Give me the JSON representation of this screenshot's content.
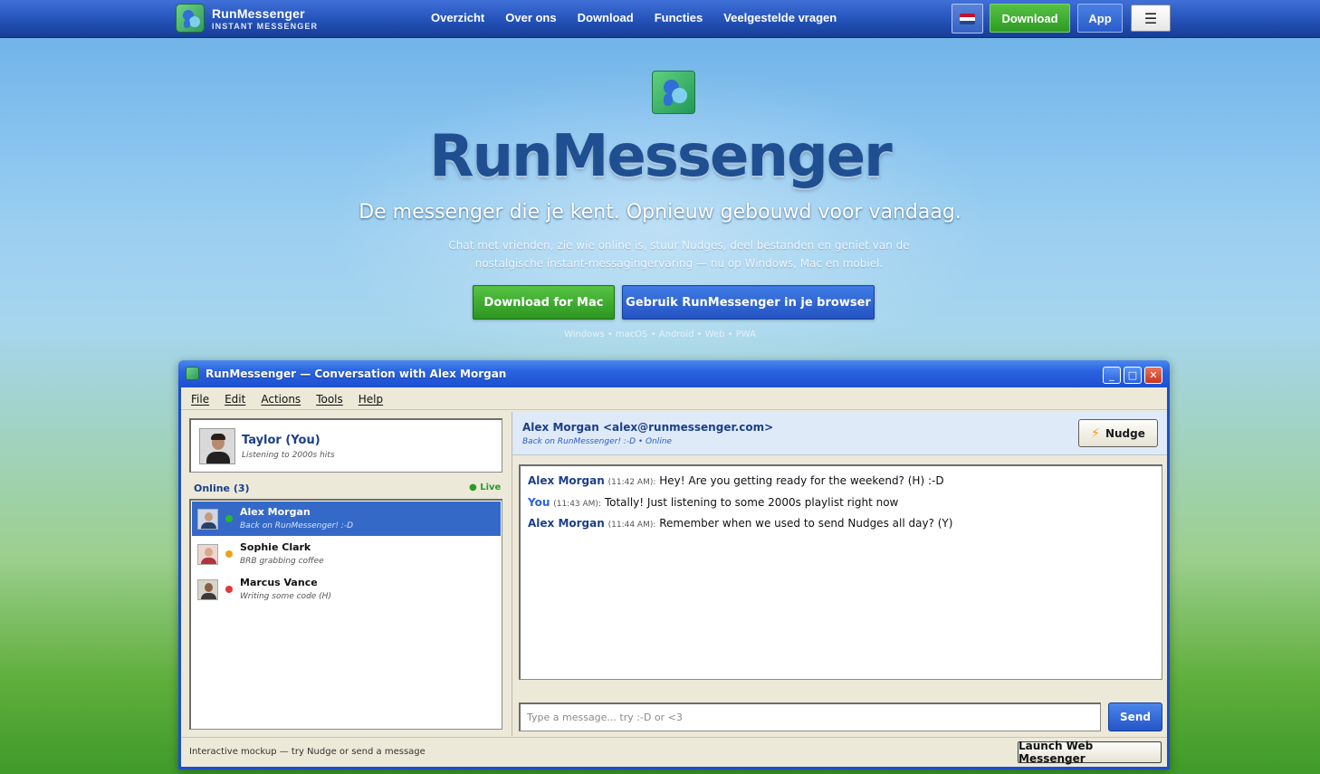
{
  "nav": {
    "brand_title": "RunMessenger",
    "brand_subtitle": "INSTANT MESSENGER",
    "links": [
      "Overzicht",
      "Over ons",
      "Download",
      "Functies",
      "Veelgestelde vragen"
    ],
    "language_flag": "flag-nl-icon",
    "download_label": "Download",
    "app_label": "App",
    "menu_icon": "hamburger-icon"
  },
  "hero": {
    "title": "RunMessenger",
    "tagline": "De messenger die je kent. Opnieuw gebouwd voor vandaag.",
    "description": "Chat met vrienden, zie wie online is, stuur Nudges, deel bestanden en geniet van de nostalgische instant-messagingervaring — nu op Windows, Mac en mobiel.",
    "cta_primary": "Download for Mac",
    "cta_secondary": "Gebruik RunMessenger in je browser",
    "platforms": "Windows • macOS • Android • Web • PWA"
  },
  "window": {
    "title": "RunMessenger — Conversation with Alex Morgan",
    "controls": {
      "minimize": "_",
      "maximize": "□",
      "close": "✕"
    },
    "menu": [
      "File",
      "Edit",
      "Actions",
      "Tools",
      "Help"
    ],
    "profile": {
      "name": "Taylor (You)",
      "status": "Listening to 2000s hits"
    },
    "online_header": "Online (3)",
    "live_label": "● Live",
    "contacts": [
      {
        "name": "Alex Morgan",
        "status": "Back on RunMessenger! :-D",
        "presence": "online",
        "presence_color": "#2db52d",
        "selected": true
      },
      {
        "name": "Sophie Clark",
        "status": "BRB grabbing coffee",
        "presence": "away",
        "presence_color": "#f0a020",
        "selected": false
      },
      {
        "name": "Marcus Vance",
        "status": "Writing some code (H)",
        "presence": "busy",
        "presence_color": "#e0393a",
        "selected": false
      }
    ],
    "chat": {
      "recipient": "Alex Morgan <alex@runmessenger.com>",
      "recipient_status": "Back on RunMessenger! :-D • Online",
      "nudge_label": "Nudge",
      "messages": [
        {
          "sender": "Alex Morgan",
          "time": "(11:42 AM):",
          "text": "Hey! Are you getting ready for the weekend? (H) :-D",
          "is_me": false
        },
        {
          "sender": "You",
          "time": "(11:43 AM):",
          "text": "Totally! Just listening to some 2000s playlist right now",
          "is_me": true
        },
        {
          "sender": "Alex Morgan",
          "time": "(11:44 AM):",
          "text": "Remember when we used to send Nudges all day? (Y)",
          "is_me": false
        }
      ],
      "input_placeholder": "Type a message... try :-D or <3",
      "input_value": "",
      "send_label": "Send"
    },
    "status_bar": {
      "text": "Interactive mockup — try Nudge or send a message",
      "launch_label": "Launch Web Messenger"
    }
  },
  "colors": {
    "nav_blue": "#2452b8",
    "title_blue": "#1f4f90",
    "cta_green": "#2c9520",
    "cta_blue": "#2453c2",
    "selection_blue": "#3469c8",
    "window_frame": "#1b4fd0"
  }
}
